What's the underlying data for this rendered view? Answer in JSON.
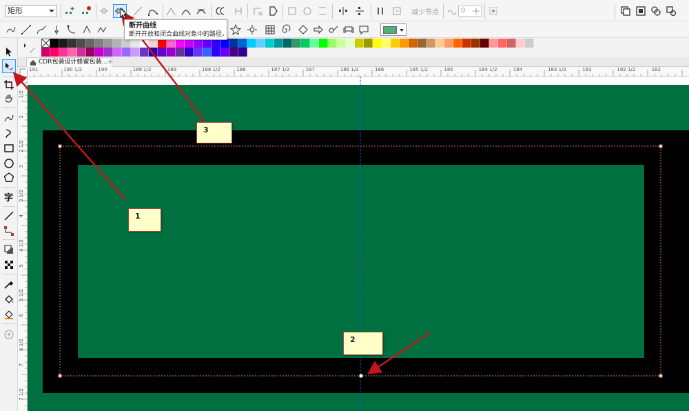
{
  "propbar": {
    "object_type": "矩形",
    "reduce_nodes_label": "减少节点",
    "curve_smoothness": "0"
  },
  "tooltip": {
    "title": "断开曲线",
    "description": "断开开放和闭合曲线对象中的路径。"
  },
  "palette": {
    "row1": [
      "#000000",
      "#1a1a1a",
      "#333333",
      "#4d4d4d",
      "#666666",
      "#808080",
      "#999999",
      "#b3b3b3",
      "#cccccc",
      "#e6e6e6",
      "#ffffff",
      "#ffd1dc",
      "#ff0000",
      "#ff66cc",
      "#ff00ff",
      "#cc00ff",
      "#9900ff",
      "#6600ff",
      "#3300ff",
      "#0000ff",
      "#003399",
      "#0066cc",
      "#00ccff",
      "#66ccff",
      "#00cccc",
      "#009999",
      "#006666",
      "#339966",
      "#00cc66",
      "#66ff99",
      "#00ff00",
      "#99ff66",
      "#ccff99",
      "#e6ffcc",
      "#cccc00",
      "#999900",
      "#ffff00",
      "#ffff66",
      "#ffcc00",
      "#ff9900",
      "#cc6600",
      "#996633",
      "#cc9966",
      "#ffcc99",
      "#ff9966",
      "#ff6600",
      "#cc3300",
      "#993300",
      "#660000",
      "#ff9999",
      "#ff6666",
      "#cc6666",
      "#ffcccc",
      "#cccccc"
    ],
    "row2": [
      "#cc0066",
      "#ff0066",
      "#ff3399",
      "#ff66aa",
      "#cc3399",
      "#990066",
      "#cc00cc",
      "#9933cc",
      "#cc66ff",
      "#9966ff",
      "#cc99ff",
      "#6633cc",
      "#330099",
      "#6600cc",
      "#9900cc",
      "#663399",
      "#3300cc",
      "#6633ff",
      "#3366ff",
      "#3300ff",
      "#6600ff",
      "#4b0082",
      "#2e008b"
    ]
  },
  "document": {
    "tab_title": "CDR包装设计蜂蜜包装..."
  },
  "rulers": {
    "top": [
      "191",
      "190 1/2",
      "190",
      "189 1/2",
      "189",
      "188 1/2",
      "188",
      "187 1/2",
      "187",
      "186 1/2",
      "186",
      "185 1/2",
      "185",
      "184 1/2",
      "184",
      "183 1/2",
      "183",
      "182 1/2",
      "182"
    ],
    "left": [
      "1/2",
      "2",
      "2 1/2",
      "3",
      "3 1/2",
      "4",
      "4 1/2",
      "5",
      "5 1/2",
      "6",
      "6 1/2",
      "7",
      "7 1/2"
    ]
  },
  "annotations": [
    {
      "label": "1"
    },
    {
      "label": "2"
    },
    {
      "label": "3"
    }
  ],
  "colors": {
    "page_green": "#007040",
    "frame_black": "#000000",
    "annotation_bg": "#ffffc8",
    "arrow_red": "#c0181e",
    "accent_blue": "#3399ff"
  }
}
